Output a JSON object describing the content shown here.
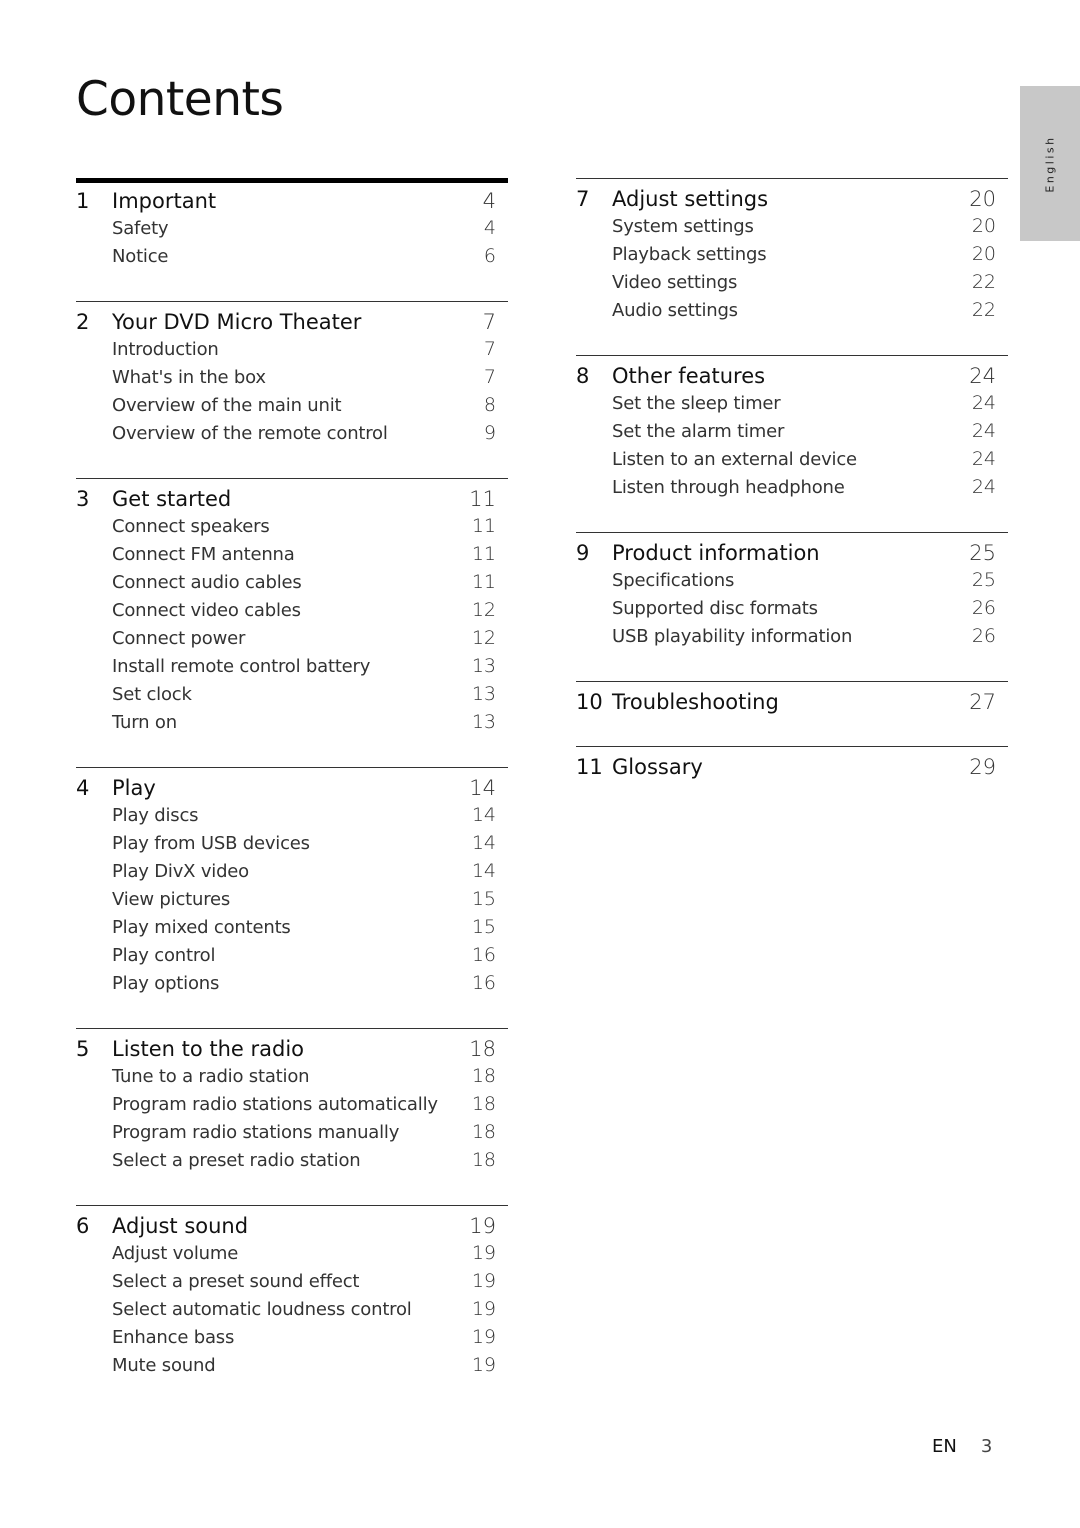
{
  "title": "Contents",
  "language_tab": "English",
  "footer": {
    "lang": "EN",
    "page": "3"
  },
  "sections": [
    {
      "num": "1",
      "title": "Important",
      "page": "4",
      "items": [
        {
          "label": "Safety",
          "page": "4"
        },
        {
          "label": "Notice",
          "page": "6"
        }
      ]
    },
    {
      "num": "2",
      "title": "Your DVD Micro Theater",
      "page": "7",
      "items": [
        {
          "label": "Introduction",
          "page": "7"
        },
        {
          "label": "What's in the box",
          "page": "7"
        },
        {
          "label": "Overview of the main unit",
          "page": "8"
        },
        {
          "label": "Overview of the remote control",
          "page": "9"
        }
      ]
    },
    {
      "num": "3",
      "title": "Get started",
      "page": "11",
      "items": [
        {
          "label": "Connect speakers",
          "page": "11"
        },
        {
          "label": "Connect FM antenna",
          "page": "11"
        },
        {
          "label": "Connect audio cables",
          "page": "11"
        },
        {
          "label": "Connect video cables",
          "page": "12"
        },
        {
          "label": "Connect power",
          "page": "12"
        },
        {
          "label": "Install remote control battery",
          "page": "13"
        },
        {
          "label": "Set clock",
          "page": "13"
        },
        {
          "label": "Turn on",
          "page": "13"
        }
      ]
    },
    {
      "num": "4",
      "title": "Play",
      "page": "14",
      "items": [
        {
          "label": "Play discs",
          "page": "14"
        },
        {
          "label": "Play from USB devices",
          "page": "14"
        },
        {
          "label": "Play DivX video",
          "page": "14"
        },
        {
          "label": "View pictures",
          "page": "15"
        },
        {
          "label": "Play mixed contents",
          "page": "15"
        },
        {
          "label": "Play control",
          "page": "16"
        },
        {
          "label": "Play options",
          "page": "16"
        }
      ]
    },
    {
      "num": "5",
      "title": "Listen to the radio",
      "page": "18",
      "items": [
        {
          "label": "Tune to a radio station",
          "page": "18"
        },
        {
          "label": "Program radio stations automatically",
          "page": "18"
        },
        {
          "label": "Program radio stations manually",
          "page": "18"
        },
        {
          "label": "Select a preset radio station",
          "page": "18"
        }
      ]
    },
    {
      "num": "6",
      "title": "Adjust sound",
      "page": "19",
      "items": [
        {
          "label": "Adjust volume",
          "page": "19"
        },
        {
          "label": "Select a preset sound effect",
          "page": "19"
        },
        {
          "label": "Select automatic loudness control",
          "page": "19"
        },
        {
          "label": "Enhance bass",
          "page": "19"
        },
        {
          "label": "Mute sound",
          "page": "19"
        }
      ]
    },
    {
      "num": "7",
      "title": "Adjust settings",
      "page": "20",
      "items": [
        {
          "label": "System settings",
          "page": "20"
        },
        {
          "label": "Playback settings",
          "page": "20"
        },
        {
          "label": "Video settings",
          "page": "22"
        },
        {
          "label": "Audio settings",
          "page": "22"
        }
      ]
    },
    {
      "num": "8",
      "title": "Other features",
      "page": "24",
      "items": [
        {
          "label": "Set the sleep timer",
          "page": "24"
        },
        {
          "label": "Set the alarm timer",
          "page": "24"
        },
        {
          "label": "Listen to an external device",
          "page": "24"
        },
        {
          "label": "Listen through headphone",
          "page": "24"
        }
      ]
    },
    {
      "num": "9",
      "title": "Product information",
      "page": "25",
      "items": [
        {
          "label": "Specifications",
          "page": "25"
        },
        {
          "label": "Supported disc formats",
          "page": "26"
        },
        {
          "label": "USB playability information",
          "page": "26"
        }
      ]
    },
    {
      "num": "10",
      "title": "Troubleshooting",
      "page": "27",
      "items": []
    },
    {
      "num": "11",
      "title": "Glossary",
      "page": "29",
      "items": []
    }
  ]
}
